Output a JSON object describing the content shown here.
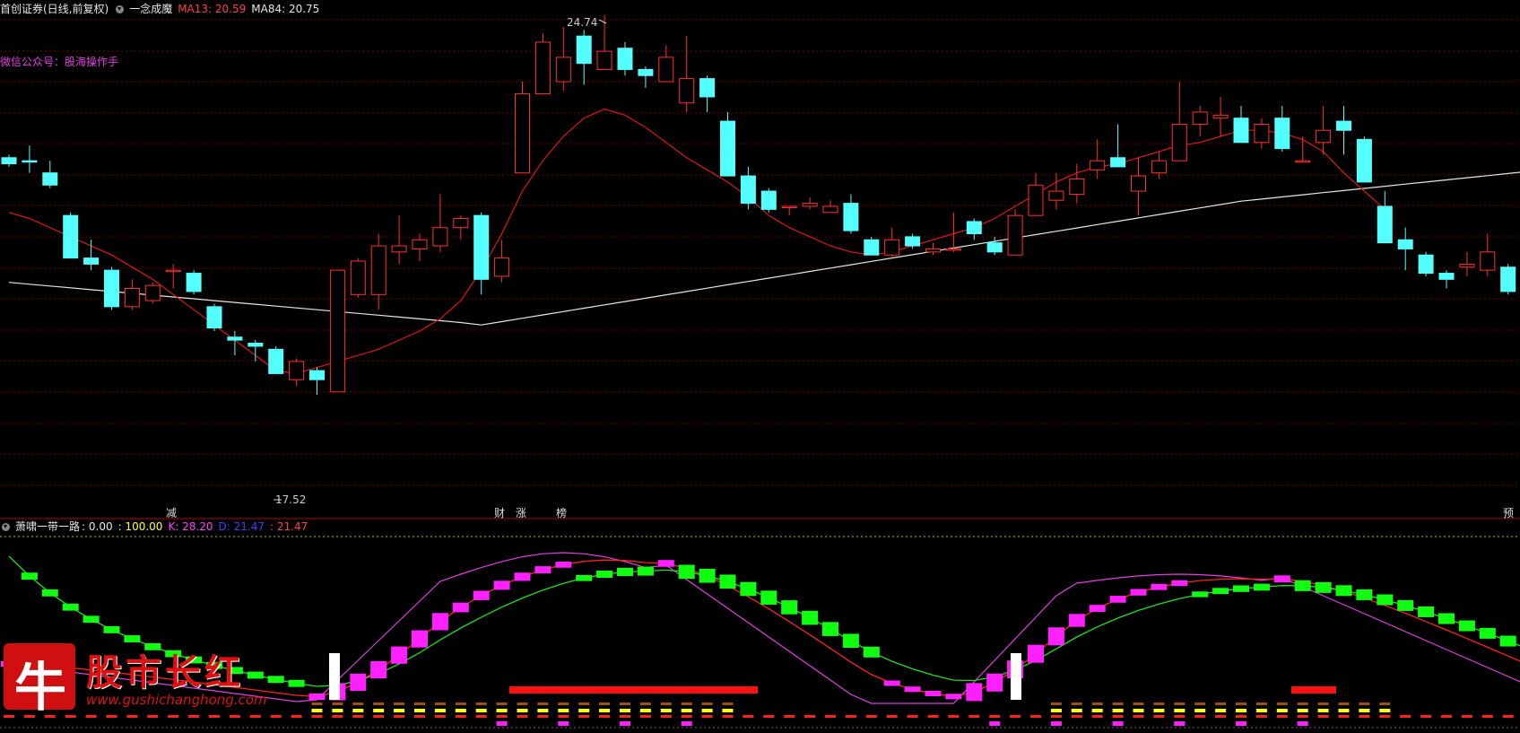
{
  "header": {
    "stock": "首创证券(日线,前复权)",
    "indicator_name": "一念成魔",
    "ma13_label": "MA13: 20.59",
    "ma84_label": "MA84: 20.75"
  },
  "watermark_text": "微信公众号：股海操作手",
  "price_annotations": {
    "high": "24.74",
    "low": "17.52"
  },
  "signal_tags": [
    {
      "text": "减",
      "color": "#2ee02e"
    },
    {
      "text": "财",
      "color": "#4aa8ff"
    },
    {
      "text": "涨",
      "color": "#ff4040"
    },
    {
      "text": "榜",
      "color": "#ffb040"
    },
    {
      "text": "预",
      "color": "#ffb040"
    }
  ],
  "sub_header": {
    "name": "萧啸一带一路",
    "v1": ": 0.00",
    "v2": ": 100.00",
    "k": "K: 28.20",
    "d": "D: 21.47",
    "j": ": 21.47"
  },
  "logo": {
    "char": "牛",
    "text": "股市长红",
    "url": "www.gushichanghong.com"
  },
  "colors": {
    "up": "#ff3030",
    "down": "#54ffff",
    "ma13": "#e01515",
    "ma84": "#e6e6e6",
    "grid": "#7a0000"
  },
  "candles": [
    [
      22.85,
      22.75,
      22.9,
      22.7
    ],
    [
      22.8,
      22.78,
      23.05,
      22.6
    ],
    [
      22.6,
      22.4,
      22.8,
      22.35
    ],
    [
      21.9,
      21.2,
      21.95,
      21.2
    ],
    [
      21.2,
      21.1,
      21.5,
      21.0
    ],
    [
      21.0,
      20.4,
      21.05,
      20.35
    ],
    [
      20.4,
      20.7,
      20.85,
      20.35
    ],
    [
      20.5,
      20.75,
      20.8,
      20.45
    ],
    [
      21.0,
      21.0,
      21.1,
      20.7
    ],
    [
      20.95,
      20.65,
      21.0,
      20.6
    ],
    [
      20.4,
      20.05,
      20.45,
      20.0
    ],
    [
      19.9,
      19.85,
      20.0,
      19.6
    ],
    [
      19.8,
      19.75,
      19.85,
      19.5
    ],
    [
      19.7,
      19.3,
      19.75,
      19.3
    ],
    [
      19.2,
      19.5,
      19.55,
      19.1
    ],
    [
      19.35,
      19.2,
      19.4,
      18.95
    ],
    [
      19.0,
      21.0,
      21.0,
      19.0
    ],
    [
      20.6,
      21.15,
      21.2,
      20.55
    ],
    [
      20.6,
      21.4,
      21.6,
      20.35
    ],
    [
      21.3,
      21.4,
      21.9,
      21.1
    ],
    [
      21.35,
      21.5,
      21.6,
      21.15
    ],
    [
      21.4,
      21.7,
      22.25,
      21.3
    ],
    [
      21.7,
      21.85,
      21.9,
      21.5
    ],
    [
      21.9,
      20.85,
      21.95,
      20.6
    ],
    [
      20.9,
      21.2,
      21.5,
      20.8
    ],
    [
      22.6,
      23.9,
      24.1,
      22.6
    ],
    [
      23.9,
      24.75,
      24.9,
      23.9
    ],
    [
      24.1,
      24.5,
      25.0,
      23.95
    ],
    [
      24.85,
      24.4,
      24.95,
      24.05
    ],
    [
      24.3,
      24.6,
      25.2,
      24.3
    ],
    [
      24.65,
      24.3,
      24.75,
      24.2
    ],
    [
      24.3,
      24.2,
      24.35,
      24.0
    ],
    [
      24.1,
      24.5,
      24.7,
      24.1
    ],
    [
      23.75,
      24.15,
      24.85,
      23.6
    ],
    [
      24.15,
      23.85,
      24.2,
      23.6
    ],
    [
      23.45,
      22.55,
      23.6,
      22.55
    ],
    [
      22.55,
      22.1,
      22.7,
      22.0
    ],
    [
      22.3,
      22.0,
      22.35,
      21.95
    ],
    [
      22.05,
      22.05,
      22.05,
      21.9
    ],
    [
      22.05,
      22.1,
      22.2,
      22.0
    ],
    [
      21.95,
      22.05,
      22.15,
      22.0
    ],
    [
      22.1,
      21.65,
      22.25,
      21.6
    ],
    [
      21.5,
      21.25,
      21.55,
      21.25
    ],
    [
      21.25,
      21.5,
      21.7,
      21.2
    ],
    [
      21.55,
      21.4,
      21.6,
      21.35
    ],
    [
      21.3,
      21.35,
      21.45,
      21.25
    ],
    [
      21.35,
      21.35,
      21.95,
      21.3
    ],
    [
      21.8,
      21.6,
      21.85,
      21.5
    ],
    [
      21.45,
      21.3,
      21.55,
      21.25
    ],
    [
      21.25,
      21.9,
      22.0,
      21.25
    ],
    [
      21.9,
      22.4,
      22.6,
      21.9
    ],
    [
      22.15,
      22.3,
      22.6,
      22.0
    ],
    [
      22.25,
      22.5,
      22.75,
      22.1
    ],
    [
      22.65,
      22.8,
      23.15,
      22.5
    ],
    [
      22.85,
      22.7,
      23.4,
      22.7
    ],
    [
      22.3,
      22.55,
      22.85,
      21.9
    ],
    [
      22.6,
      22.8,
      22.95,
      22.5
    ],
    [
      22.8,
      23.4,
      24.1,
      22.8
    ],
    [
      23.4,
      23.6,
      23.7,
      23.2
    ],
    [
      23.5,
      23.55,
      23.85,
      23.2
    ],
    [
      23.5,
      23.1,
      23.7,
      23.1
    ],
    [
      23.1,
      23.4,
      23.5,
      23.0
    ],
    [
      23.5,
      23.0,
      23.7,
      22.95
    ],
    [
      22.8,
      22.8,
      23.2,
      22.8
    ],
    [
      23.1,
      23.3,
      23.7,
      22.9
    ],
    [
      23.45,
      23.3,
      23.7,
      22.9
    ],
    [
      23.15,
      22.45,
      23.2,
      22.45
    ],
    [
      22.05,
      21.45,
      22.3,
      21.45
    ],
    [
      21.5,
      21.35,
      21.7,
      21.0
    ],
    [
      21.25,
      20.95,
      21.3,
      20.9
    ],
    [
      20.95,
      20.85,
      21.0,
      20.7
    ],
    [
      21.05,
      21.1,
      21.3,
      20.9
    ],
    [
      21.0,
      21.3,
      21.6,
      20.9
    ],
    [
      21.05,
      20.65,
      21.1,
      20.6
    ],
    [
      21.0,
      21.5,
      21.6,
      20.7
    ]
  ],
  "ma13": [
    21.95,
    21.85,
    21.7,
    21.55,
    21.4,
    21.25,
    21.05,
    20.85,
    20.6,
    20.35,
    20.1,
    19.85,
    19.6,
    19.35,
    19.3,
    19.4,
    19.5,
    19.6,
    19.7,
    19.85,
    20.0,
    20.2,
    20.5,
    21.0,
    21.6,
    22.3,
    22.8,
    23.2,
    23.5,
    23.65,
    23.55,
    23.35,
    23.1,
    22.85,
    22.65,
    22.45,
    22.2,
    21.9,
    21.7,
    21.55,
    21.4,
    21.3,
    21.25,
    21.3,
    21.4,
    21.5,
    21.6,
    21.7,
    21.85,
    22.05,
    22.25,
    22.45,
    22.6,
    22.7,
    22.75,
    22.85,
    22.95,
    23.05,
    23.1,
    23.2,
    23.3,
    23.3,
    23.25,
    23.15,
    22.95,
    22.6,
    22.3,
    22.0
  ]
}
